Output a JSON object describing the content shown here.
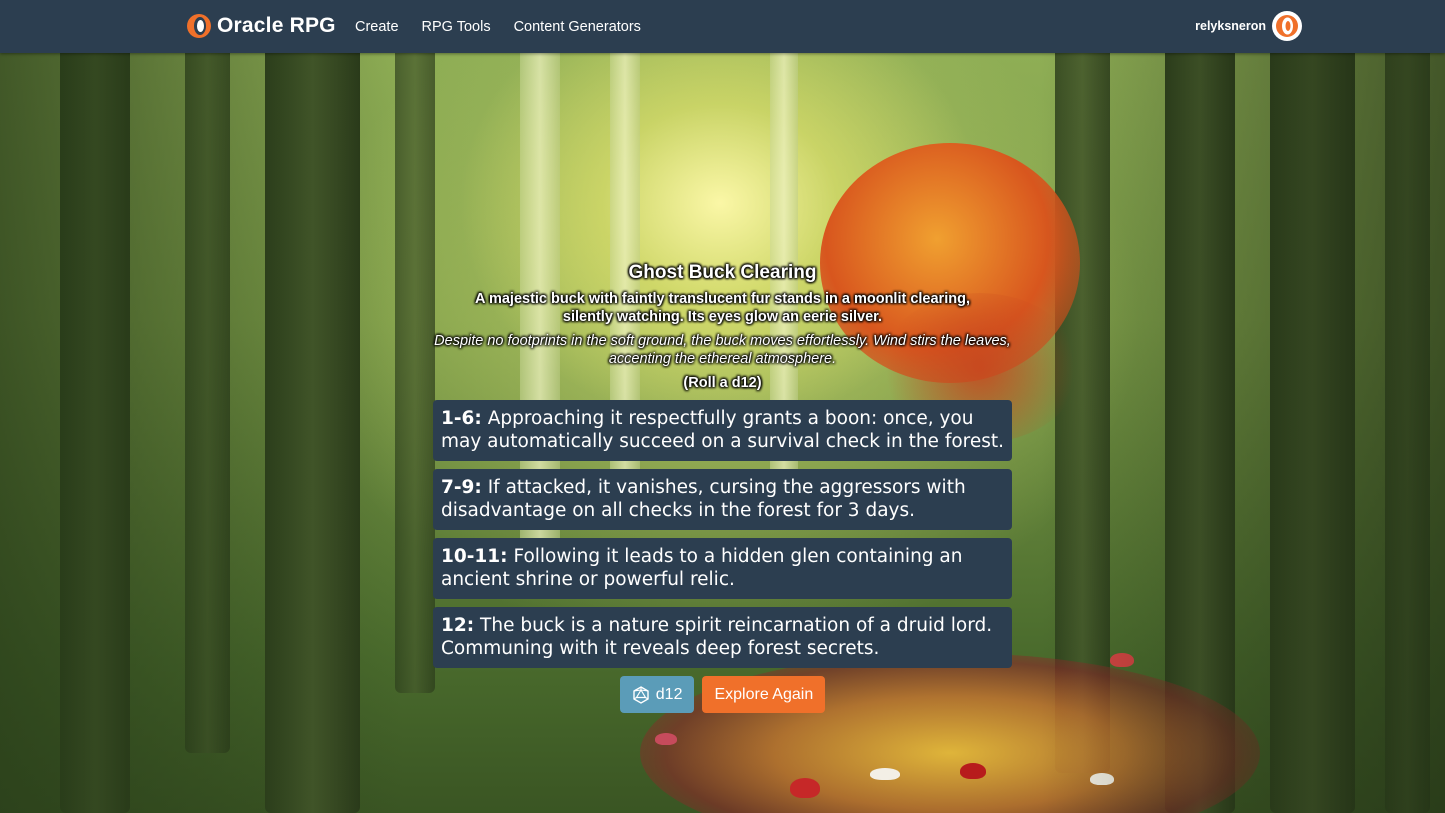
{
  "navbar": {
    "brand": "Oracle RPG",
    "links": [
      "Create",
      "RPG Tools",
      "Content Generators"
    ],
    "username": "relyksneron"
  },
  "encounter": {
    "title": "Ghost Buck Clearing",
    "description": "A majestic buck with faintly translucent fur stands in a moonlit clearing, silently watching. Its eyes glow an eerie silver.",
    "flavor": "Despite no footprints in the soft ground, the buck moves effortlessly. Wind stirs the leaves, accenting the ethereal atmosphere.",
    "roll": "(Roll a d12)",
    "options": [
      {
        "range": "1-6:",
        "text": "Approaching it respectfully grants a boon: once, you may automatically succeed on a survival check in the forest."
      },
      {
        "range": "7-9:",
        "text": "If attacked, it vanishes, cursing the aggressors with disadvantage on all checks in the forest for 3 days."
      },
      {
        "range": "10-11:",
        "text": "Following it leads to a hidden glen containing an ancient shrine or powerful relic."
      },
      {
        "range": "12:",
        "text": "The buck is a nature spirit reincarnation of a druid lord. Communing with it reveals deep forest secrets."
      }
    ]
  },
  "buttons": {
    "dice_label": "d12",
    "explore_label": "Explore Again"
  },
  "icons": {
    "brand": "oracle-ring-icon",
    "avatar": "user-avatar-icon",
    "dice": "d20-dice-icon"
  },
  "colors": {
    "navbar": "#2c3e50",
    "option_bg": "#2c3e50",
    "dice_button": "#5b9cb8",
    "explore_button": "#f0702a",
    "brand_accent": "#f0702a"
  }
}
